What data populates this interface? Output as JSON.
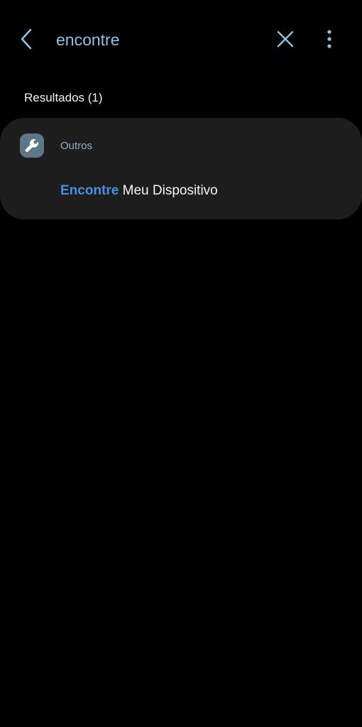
{
  "search": {
    "query": "encontre",
    "back_icon": "chevron-left-icon",
    "clear_icon": "close-icon",
    "more_icon": "more-vertical-icon"
  },
  "results": {
    "header": "Resultados (1)",
    "groups": [
      {
        "category": "Outros",
        "icon": "wrench-icon",
        "icon_color": "#5f7688",
        "items": [
          {
            "highlight": "Encontre",
            "rest": " Meu Dispositivo"
          }
        ]
      }
    ]
  },
  "colors": {
    "background": "#000000",
    "card": "#1d1d1d",
    "query_text": "#8fc1e3",
    "highlight": "#4a8fe0"
  }
}
